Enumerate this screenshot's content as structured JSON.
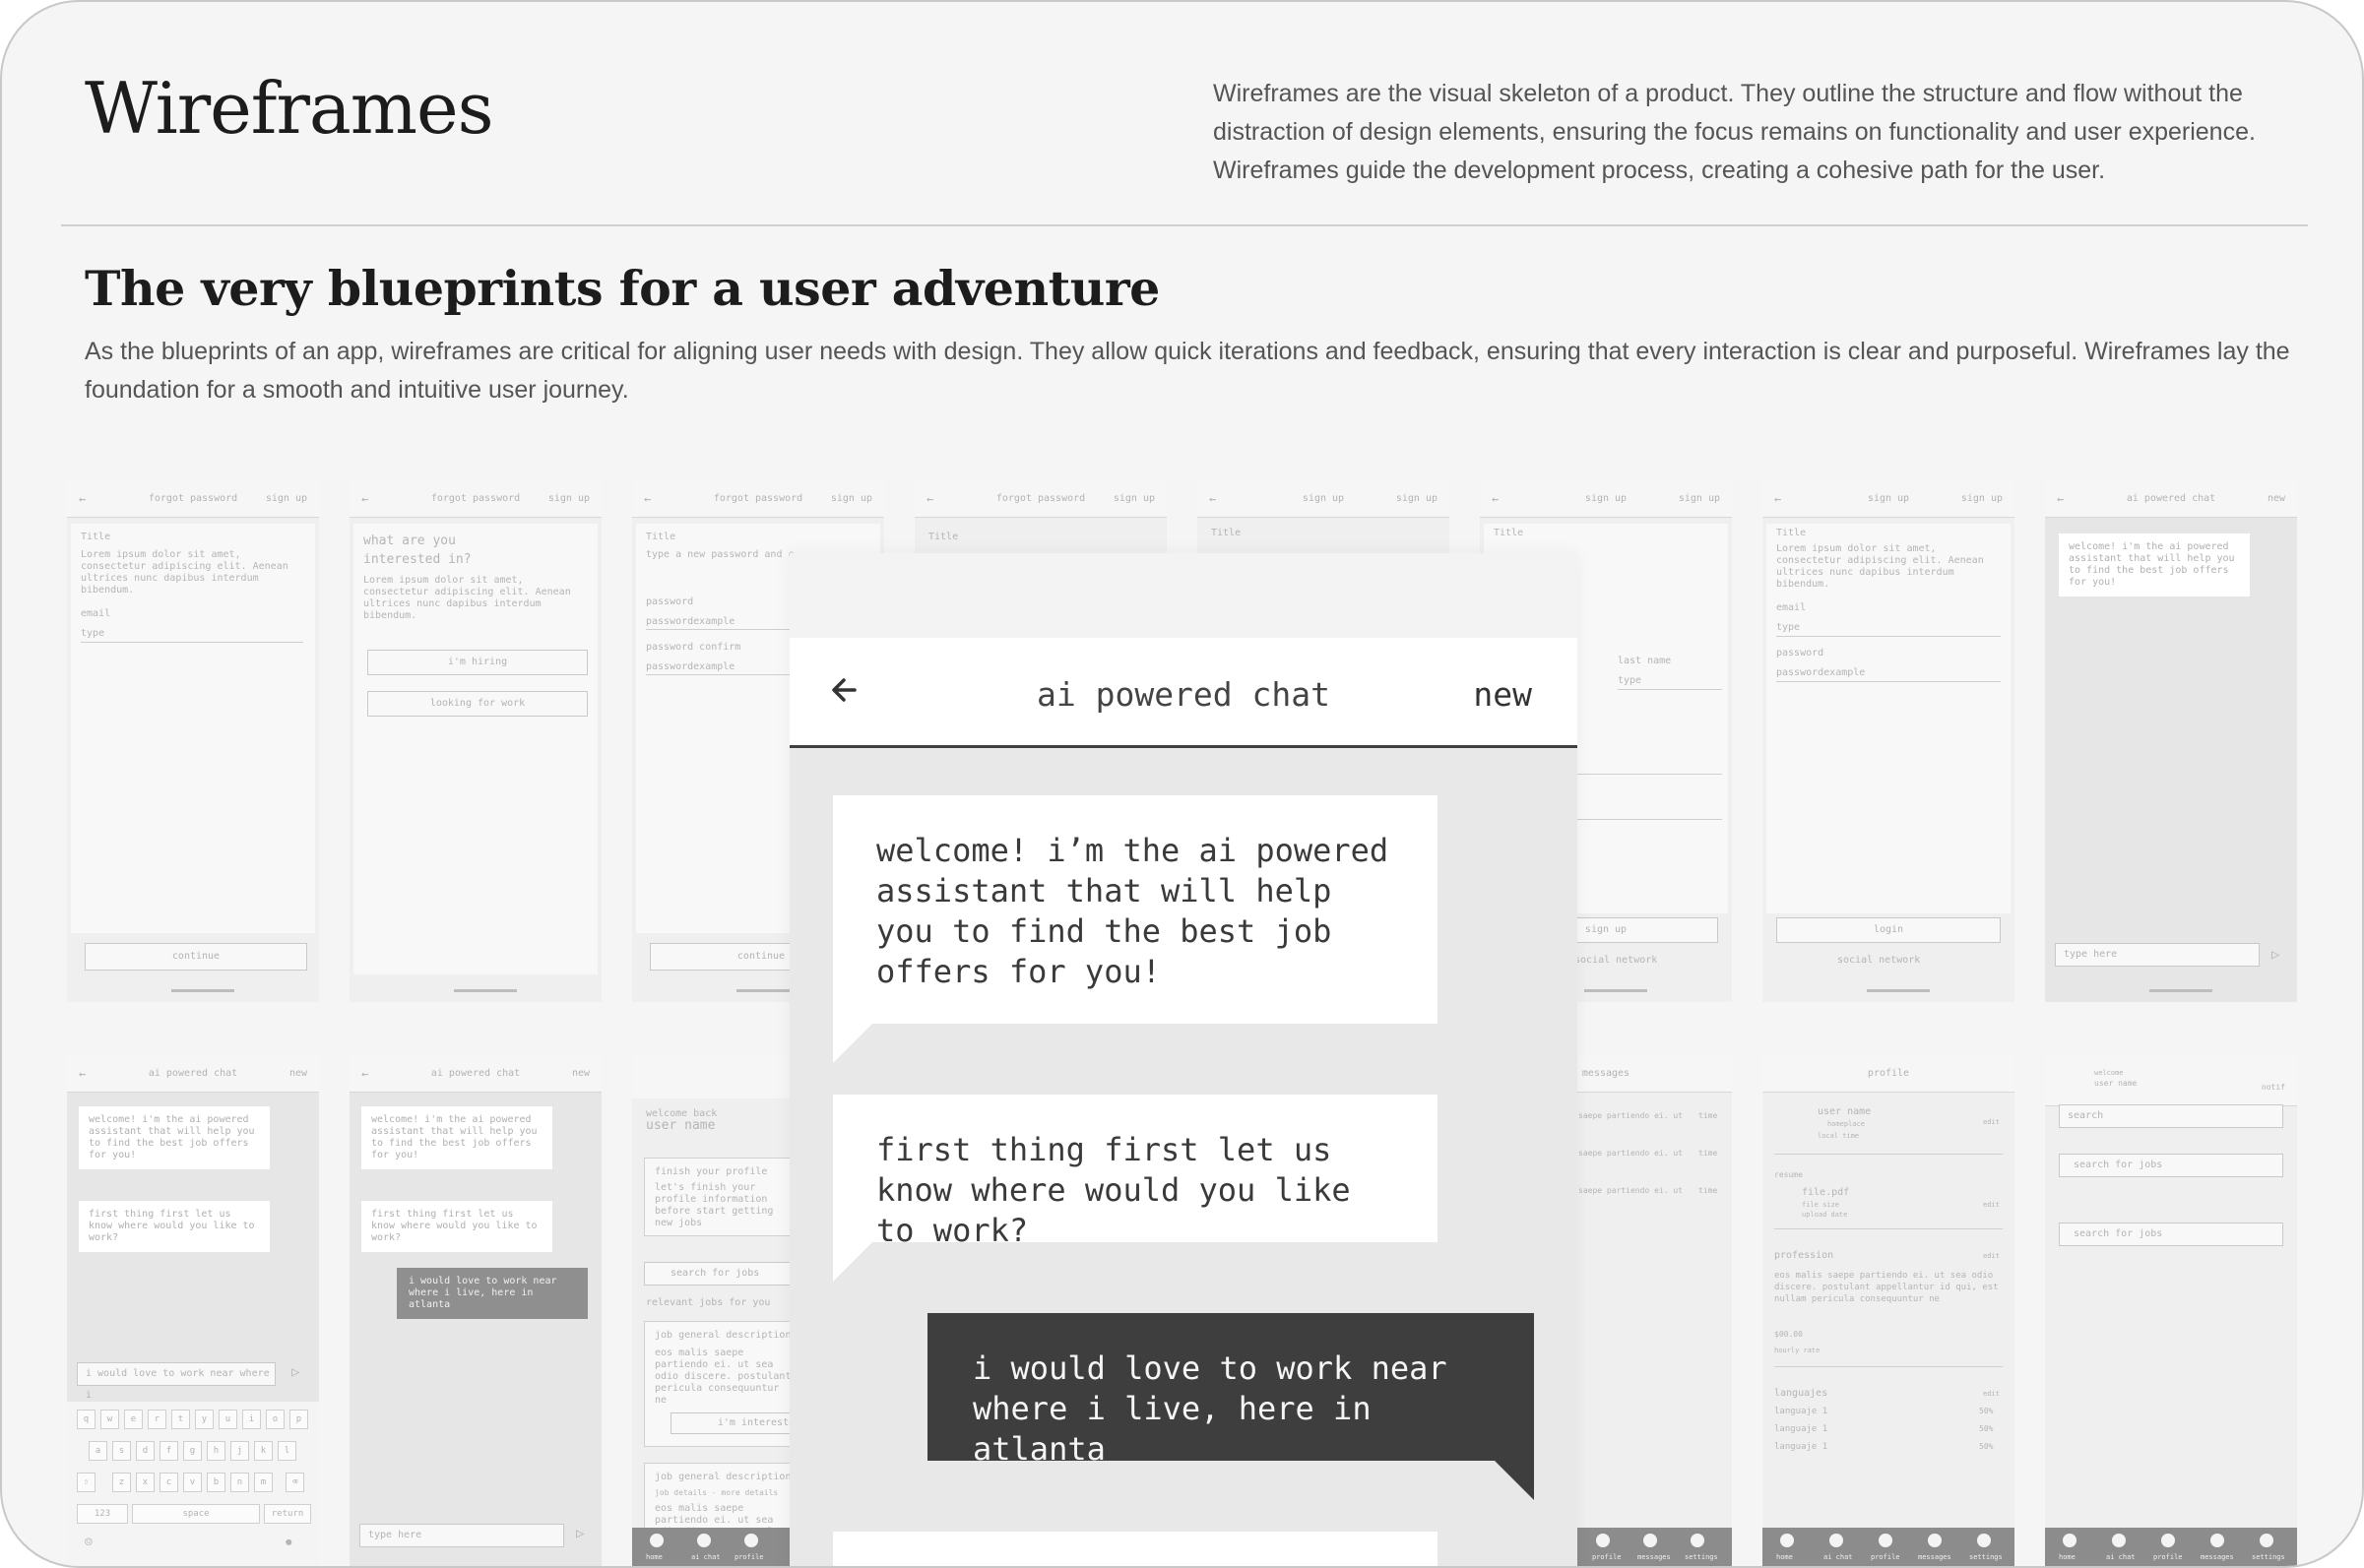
{
  "header": {
    "title": "Wireframes",
    "intro": "Wireframes are the visual skeleton of a product. They outline the structure and flow without the distraction of design elements, ensuring the focus remains on functionality and user experience. Wireframes guide the development process, creating a cohesive path for the user."
  },
  "section": {
    "title": "The very blueprints for a user adventure",
    "body": "As the blueprints of an app, wireframes are critical for aligning user needs with design. They allow quick iterations and feedback, ensuring that every interaction is clear and purposeful. Wireframes lay the foundation for a smooth and intuitive user journey."
  },
  "colors": {
    "background": "#f5f5f5",
    "dark_bubble": "#3e3e3e",
    "light_bubble": "#ffffff"
  },
  "thumbs": {
    "forgot_password": "forgot password",
    "sign_up": "sign up",
    "ai_powered_chat": "ai powered chat",
    "new": "new",
    "messages": "messages",
    "profile": "profile",
    "title": "Title",
    "lorem": "Lorem ipsum dolor sit amet, consectetur adipiscing elit. Aenean ultrices nunc dapibus interdum bibendum.",
    "email": "email",
    "type": "type",
    "continue": "continue",
    "what_interested": "what are you interested in?",
    "im_hiring": "i'm hiring",
    "looking_for_work": "looking for work",
    "new_password_hint": "type a new password and c",
    "password": "password",
    "passwordexample": "passwordexample",
    "password_confirm": "password confirm",
    "last_name": "last name",
    "login": "login",
    "social_network": "social network",
    "type_here": "type here",
    "chat_welcome": "welcome! i'm the ai powered assistant that will help you to find the best job offers for you!",
    "chat_question": "first thing first let us know where would you like to work?",
    "chat_answer": "i would love to work near where i live, here in atlanta",
    "chat_input": "i would love to work near where i",
    "space": "space",
    "return": "return",
    "k123": "123",
    "welcome_back": "welcome back",
    "user_name": "user name",
    "finish_profile": "finish your profile",
    "finish_profile_desc": "let's finish your profile information before start getting new jobs",
    "search_for_jobs": "search for jobs",
    "relevant_jobs": "relevant jobs for you",
    "job_general": "job general description",
    "job_details": "job details - more details",
    "job_body": "eos malis saepe partiendo ei. ut sea odio discere. postulant pericula consequuntur ne",
    "im_interested": "i'm interested",
    "msg_line": "saepe partiendo ei. ut",
    "time": "time",
    "user_name2": "user name",
    "homeplace": "homeplace",
    "local_time": "local time",
    "edit": "edit",
    "resume": "resume",
    "file_pdf": "file.pdf",
    "file_size": "file size",
    "upload_date": "upload date",
    "profession": "profession",
    "profession_body": "eos malis saepe partiendo ei. ut sea odio discere. postulant appellantur id qui, est nullam pericula consequuntur ne",
    "rate": "$00.00",
    "hourly_rate": "hourly rate",
    "languages": "languajes",
    "lang1": "languaje 1",
    "pct": "50%",
    "welcome": "welcome",
    "notif": "notif",
    "search": "search",
    "tabs": [
      "home",
      "ai chat",
      "profile",
      "messages",
      "settings"
    ]
  },
  "phone": {
    "title": "ai powered chat",
    "new_label": "new",
    "welcome": "welcome! i’m the ai powered assistant that will help you to find the best job offers for you!",
    "question": "first thing first let us know where would you like to work?",
    "answer": "i would love to work near where i live, here in atlanta"
  }
}
